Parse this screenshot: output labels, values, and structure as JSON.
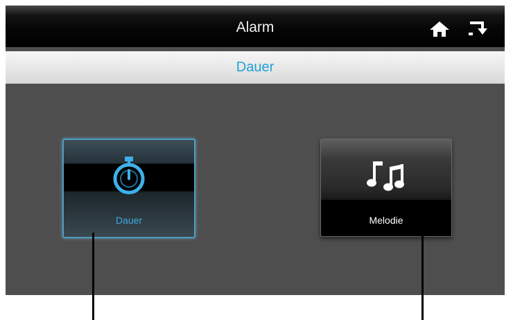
{
  "header": {
    "title": "Alarm",
    "home_icon": "home-icon",
    "back_icon": "back-icon"
  },
  "subheader": {
    "title": "Dauer"
  },
  "tiles": [
    {
      "label": "Dauer",
      "icon": "stopwatch-icon",
      "selected": true
    },
    {
      "label": "Melodie",
      "icon": "music-notes-icon",
      "selected": false
    }
  ],
  "colors": {
    "accent": "#22a0d8",
    "screen_bg": "#4e4e4e",
    "title_bar": "#000000",
    "subbar": "#e6e6e6"
  }
}
